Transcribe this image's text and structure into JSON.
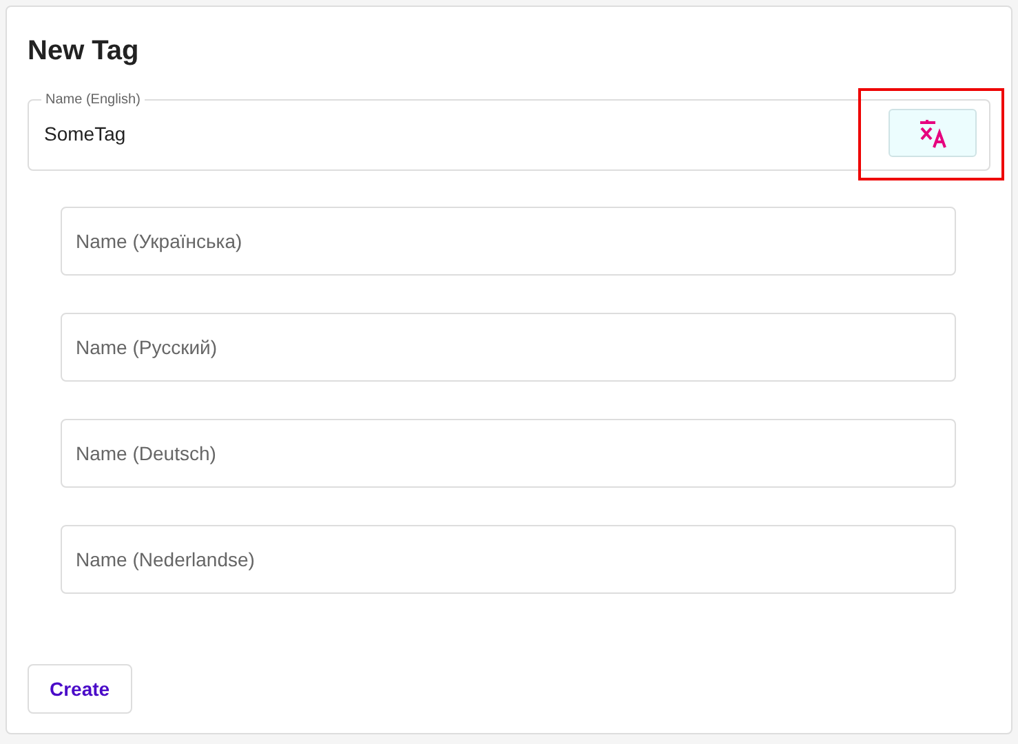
{
  "title": "New Tag",
  "primary_field": {
    "label": "Name (English)",
    "value": "SomeTag",
    "translate_button": {
      "highlighted": true
    }
  },
  "translation_fields": [
    {
      "placeholder": "Name (Українська)"
    },
    {
      "placeholder": "Name (Русский)"
    },
    {
      "placeholder": "Name (Deutsch)"
    },
    {
      "placeholder": "Name (Nederlandse)"
    }
  ],
  "buttons": [
    "Create"
  ]
}
